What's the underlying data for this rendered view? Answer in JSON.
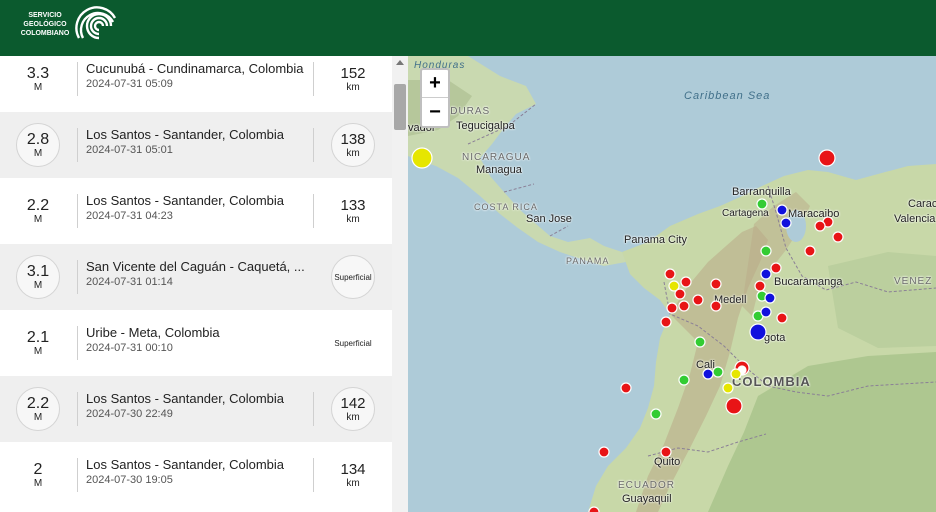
{
  "header": {
    "logo_line1": "SERVICIO",
    "logo_line2": "GEOLÓGICO",
    "logo_line3": "COLOMBIANO"
  },
  "events": [
    {
      "magnitude": "3.3",
      "mag_unit": "M",
      "place": "Cucunubá - Cundinamarca, Colombia",
      "datetime": "2024-07-31 05:09",
      "depth": "152",
      "depth_unit": "km"
    },
    {
      "magnitude": "2.8",
      "mag_unit": "M",
      "place": "Los Santos - Santander, Colombia",
      "datetime": "2024-07-31 05:01",
      "depth": "138",
      "depth_unit": "km"
    },
    {
      "magnitude": "2.2",
      "mag_unit": "M",
      "place": "Los Santos - Santander, Colombia",
      "datetime": "2024-07-31 04:23",
      "depth": "133",
      "depth_unit": "km"
    },
    {
      "magnitude": "3.1",
      "mag_unit": "M",
      "place": "San Vicente del Caguán - Caquetá, ...",
      "datetime": "2024-07-31 01:14",
      "depth_label": "Superficial"
    },
    {
      "magnitude": "2.1",
      "mag_unit": "M",
      "place": "Uribe - Meta, Colombia",
      "datetime": "2024-07-31 00:10",
      "depth_label": "Superficial"
    },
    {
      "magnitude": "2.2",
      "mag_unit": "M",
      "place": "Los Santos - Santander, Colombia",
      "datetime": "2024-07-30 22:49",
      "depth": "142",
      "depth_unit": "km"
    },
    {
      "magnitude": "2",
      "mag_unit": "M",
      "place": "Los Santos - Santander, Colombia",
      "datetime": "2024-07-30 19:05",
      "depth": "134",
      "depth_unit": "km"
    }
  ],
  "map": {
    "zoom_in": "+",
    "zoom_out": "−",
    "labels": {
      "honduras": "Honduras",
      "caribbean_sea": "Caribbean  Sea",
      "honduras_country": "NDURAS",
      "salvador": "vador",
      "tegucigalpa": "Tegucigalpa",
      "nicaragua": "NICARAGUA",
      "managua": "Managua",
      "costa_rica": "COSTA RICA",
      "san_jose": "San Jose",
      "panama_city": "Panama City",
      "panama": "PANAMA",
      "barranquilla": "Barranquilla",
      "cartagena": "Cartagena",
      "maracaibo": "Maracaibo",
      "caracas_partial": "Caraca",
      "valencia": "Valencia",
      "venezuela": "VENEZ",
      "bucaramanga": "Bucaramanga",
      "medellin": "Medell",
      "bogota": "gota",
      "cali": "Cali",
      "colombia": "COLOMBIA",
      "ecuador": "ECUADOR",
      "quito": "Quito",
      "guayaquil": "Guayaquil"
    },
    "marker_colors": {
      "superficial": "#e81416",
      "intermedio": "#33cc33",
      "profundo": "#1111dd",
      "yellow": "#e6e600"
    }
  }
}
